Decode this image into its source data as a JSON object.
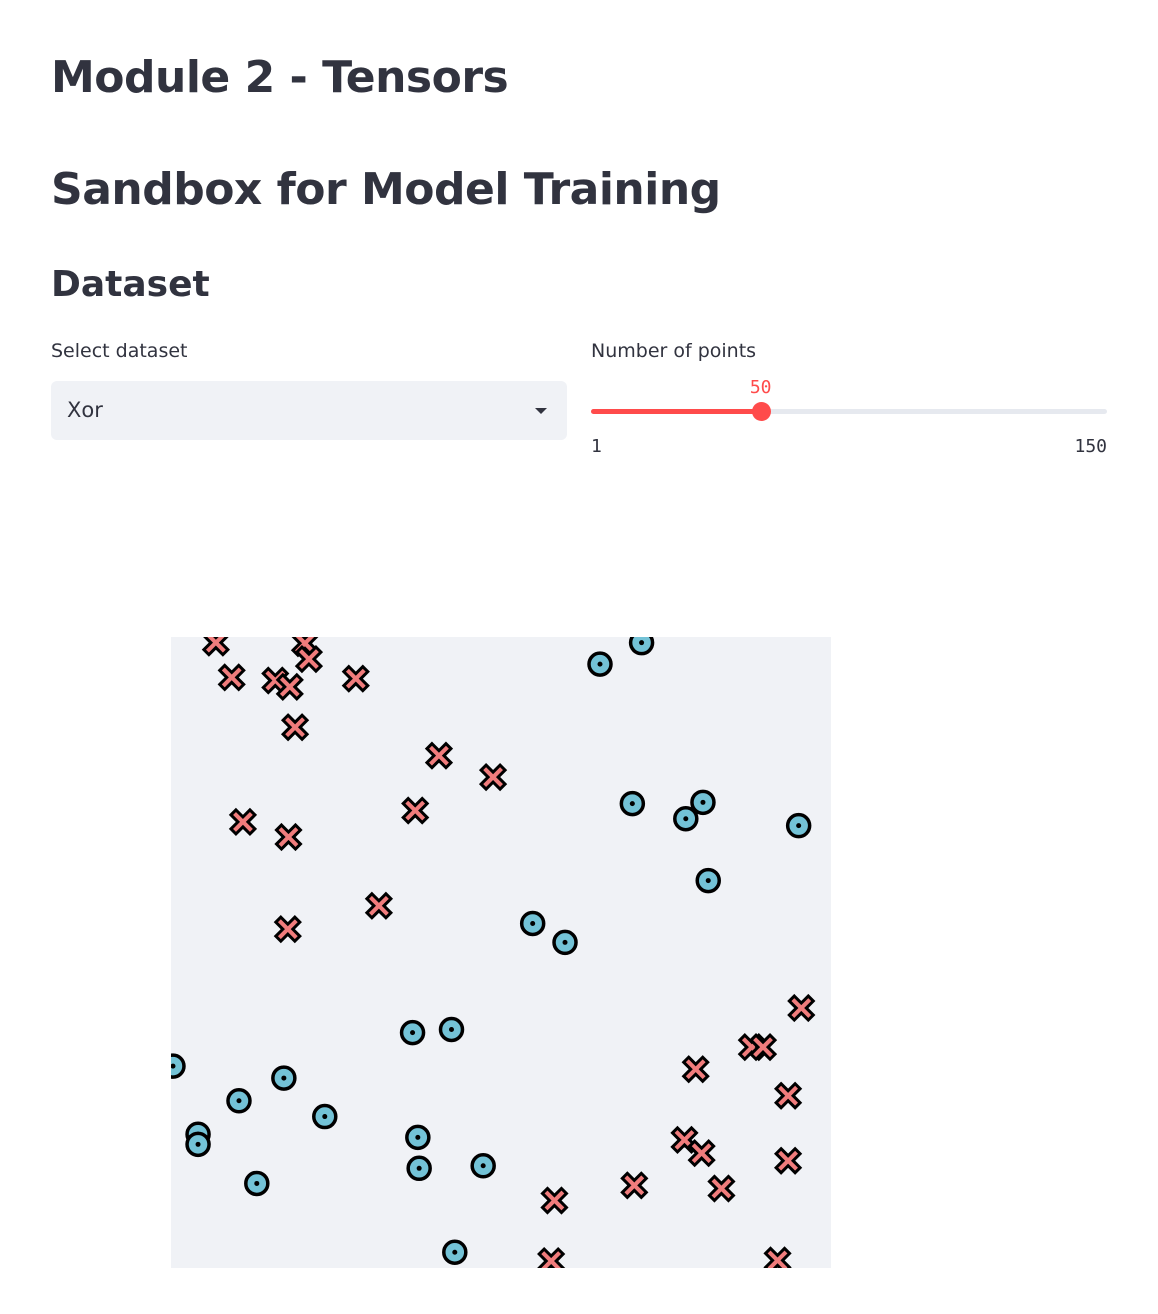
{
  "page": {
    "title": "Module 2 - Tensors",
    "subtitle": "Sandbox for Model Training",
    "section": "Dataset"
  },
  "dataset_select": {
    "label": "Select dataset",
    "value": "Xor"
  },
  "points_slider": {
    "label": "Number of points",
    "value": 50,
    "value_text": "50",
    "min": 1,
    "max": 150,
    "min_text": "1",
    "max_text": "150"
  },
  "colors": {
    "accent": "#ff4b4b",
    "plot_bg": "#f0f2f6",
    "circle_fill": "#73c2d6",
    "cross_fill": "#f07c7c",
    "marker_outline": "#000000"
  },
  "chart_data": {
    "type": "scatter",
    "title": "",
    "xlabel": "",
    "ylabel": "",
    "xlim": [
      0,
      1
    ],
    "ylim": [
      0,
      1
    ],
    "grid": false,
    "series": [
      {
        "marker": "circle",
        "points": [
          [
            0.65,
            0.957
          ],
          [
            0.713,
            0.991
          ],
          [
            0.699,
            0.736
          ],
          [
            0.78,
            0.712
          ],
          [
            0.806,
            0.738
          ],
          [
            0.951,
            0.701
          ],
          [
            0.814,
            0.614
          ],
          [
            0.548,
            0.546
          ],
          [
            0.597,
            0.516
          ],
          [
            0.366,
            0.373
          ],
          [
            0.425,
            0.378
          ],
          [
            0.003,
            0.32
          ],
          [
            0.171,
            0.301
          ],
          [
            0.103,
            0.265
          ],
          [
            0.233,
            0.24
          ],
          [
            0.041,
            0.212
          ],
          [
            0.041,
            0.196
          ],
          [
            0.374,
            0.207
          ],
          [
            0.376,
            0.158
          ],
          [
            0.473,
            0.162
          ],
          [
            0.13,
            0.134
          ],
          [
            0.43,
            0.025
          ]
        ]
      },
      {
        "marker": "cross",
        "points": [
          [
            0.068,
            0.991
          ],
          [
            0.203,
            0.99
          ],
          [
            0.209,
            0.965
          ],
          [
            0.092,
            0.936
          ],
          [
            0.158,
            0.931
          ],
          [
            0.18,
            0.921
          ],
          [
            0.28,
            0.934
          ],
          [
            0.188,
            0.857
          ],
          [
            0.406,
            0.812
          ],
          [
            0.488,
            0.778
          ],
          [
            0.37,
            0.725
          ],
          [
            0.109,
            0.707
          ],
          [
            0.178,
            0.683
          ],
          [
            0.315,
            0.574
          ],
          [
            0.177,
            0.537
          ],
          [
            0.955,
            0.412
          ],
          [
            0.88,
            0.35
          ],
          [
            0.897,
            0.35
          ],
          [
            0.795,
            0.315
          ],
          [
            0.935,
            0.273
          ],
          [
            0.778,
            0.203
          ],
          [
            0.804,
            0.182
          ],
          [
            0.935,
            0.17
          ],
          [
            0.702,
            0.131
          ],
          [
            0.834,
            0.126
          ],
          [
            0.581,
            0.107
          ],
          [
            0.576,
            0.011
          ],
          [
            0.919,
            0.012
          ]
        ]
      }
    ]
  }
}
